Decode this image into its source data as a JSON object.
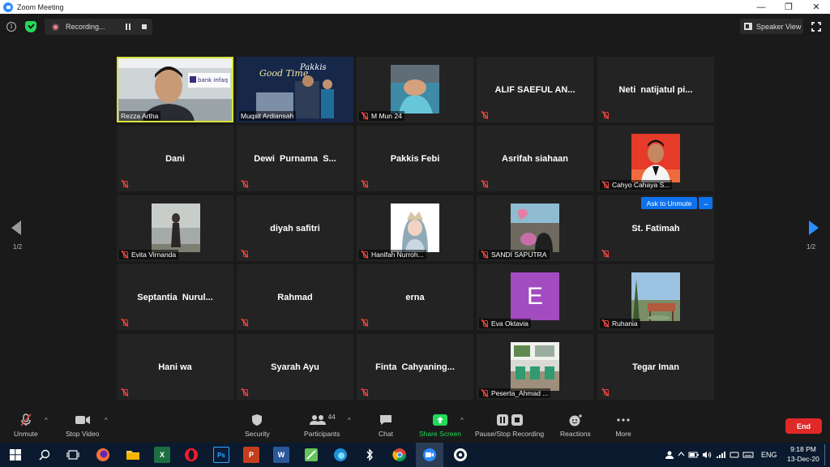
{
  "window": {
    "title": "Zoom Meeting",
    "minimize_glyph": "—",
    "restore_glyph": "❐",
    "close_glyph": "✕"
  },
  "topbar": {
    "info_glyph": "i",
    "recording_text": "Recording...",
    "speaker_view_label": "Speaker View"
  },
  "pagination": {
    "left_page": "1/2",
    "right_page": "1/2"
  },
  "participants": [
    {
      "name": "Rezza Artha",
      "display": "video",
      "active": true
    },
    {
      "name": "Muqsit Ardiansah",
      "display": "video"
    },
    {
      "name": "M Mun 24",
      "display": "thumb"
    },
    {
      "name": "ALIF SAEFUL AN...",
      "display": "name"
    },
    {
      "name": "Neti  natijatul pi...",
      "display": "name"
    },
    {
      "name": "Dani",
      "display": "name"
    },
    {
      "name": "Dewi  Purnama  S...",
      "display": "name"
    },
    {
      "name": "Pakkis Febi",
      "display": "name"
    },
    {
      "name": "Asrifah siahaan",
      "display": "name"
    },
    {
      "name": "Cahyo Cahaya S...",
      "display": "thumb"
    },
    {
      "name": "Evita Virnanda",
      "display": "thumb"
    },
    {
      "name": "diyah safitri",
      "display": "name"
    },
    {
      "name": "Hanifah Nurroh...",
      "display": "thumb"
    },
    {
      "name": "SANDI SAPUTRA",
      "display": "thumb"
    },
    {
      "name": "St. Fatimah",
      "display": "name"
    },
    {
      "name": "Septantia  Nurul...",
      "display": "name"
    },
    {
      "name": "Rahmad",
      "display": "name"
    },
    {
      "name": "erna",
      "display": "name"
    },
    {
      "name": "Eva Oktavia",
      "display": "avatar",
      "initial": "E"
    },
    {
      "name": "Ruhania",
      "display": "thumb"
    },
    {
      "name": "Hani wa",
      "display": "name"
    },
    {
      "name": "Syarah Ayu",
      "display": "name"
    },
    {
      "name": "Finta  Cahyaning...",
      "display": "name"
    },
    {
      "name": "Peserta_Ahmad ...",
      "display": "thumb"
    },
    {
      "name": "Tegar Iman",
      "display": "name"
    }
  ],
  "hover_actions": {
    "ask_unmute": "Ask to Unmute",
    "more": "..."
  },
  "toolbar": {
    "unmute": "Unmute",
    "stop_video": "Stop Video",
    "security": "Security",
    "participants": "Participants",
    "participant_count": "44",
    "chat": "Chat",
    "share_screen": "Share Screen",
    "pause_stop_recording": "Pause/Stop Recording",
    "reactions": "Reactions",
    "more": "More",
    "end": "End",
    "caret": "^"
  },
  "taskbar": {
    "excel": "X",
    "powerpoint": "P",
    "word": "W",
    "photoshop": "Ps",
    "language": "ENG",
    "time": "9:18 PM",
    "date": "13-Dec-20"
  },
  "colors": {
    "accent_blue": "#2d8cff",
    "share_green": "#23d959",
    "end_red": "#e02828",
    "mute_red": "#e0443e",
    "active_speaker": "#d7e43a"
  }
}
